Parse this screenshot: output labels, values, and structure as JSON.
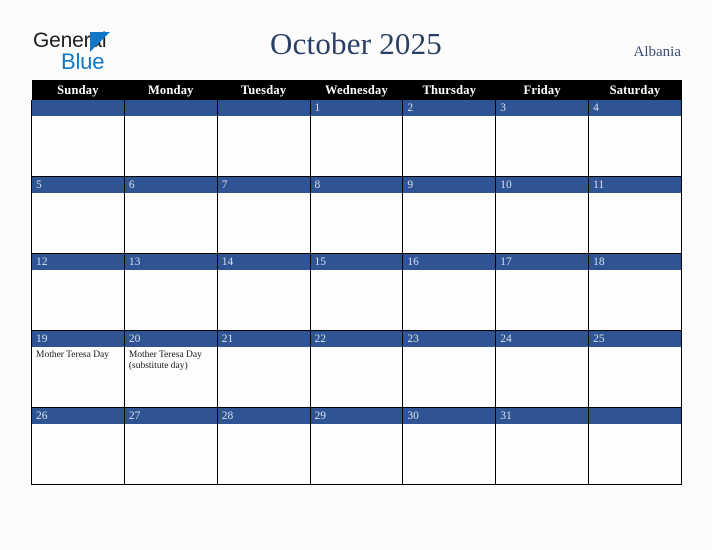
{
  "brand": {
    "name_part1": "General",
    "name_part2": "Blue",
    "triangle_color": "#1277c4"
  },
  "header": {
    "title": "October 2025",
    "region": "Albania"
  },
  "colors": {
    "header_row_bg": "#000000",
    "day_band_bg": "#2e5494",
    "day_number_text": "#d9dfeb",
    "title_text": "#2b3f66",
    "page_bg": "#fcfcfd",
    "grid_line": "#000000"
  },
  "calendar": {
    "weekday_headers": [
      "Sunday",
      "Monday",
      "Tuesday",
      "Wednesday",
      "Thursday",
      "Friday",
      "Saturday"
    ],
    "weeks": [
      [
        {
          "day": "",
          "events": []
        },
        {
          "day": "",
          "events": []
        },
        {
          "day": "",
          "events": []
        },
        {
          "day": "1",
          "events": []
        },
        {
          "day": "2",
          "events": []
        },
        {
          "day": "3",
          "events": []
        },
        {
          "day": "4",
          "events": []
        }
      ],
      [
        {
          "day": "5",
          "events": []
        },
        {
          "day": "6",
          "events": []
        },
        {
          "day": "7",
          "events": []
        },
        {
          "day": "8",
          "events": []
        },
        {
          "day": "9",
          "events": []
        },
        {
          "day": "10",
          "events": []
        },
        {
          "day": "11",
          "events": []
        }
      ],
      [
        {
          "day": "12",
          "events": []
        },
        {
          "day": "13",
          "events": []
        },
        {
          "day": "14",
          "events": []
        },
        {
          "day": "15",
          "events": []
        },
        {
          "day": "16",
          "events": []
        },
        {
          "day": "17",
          "events": []
        },
        {
          "day": "18",
          "events": []
        }
      ],
      [
        {
          "day": "19",
          "events": [
            "Mother Teresa Day"
          ]
        },
        {
          "day": "20",
          "events": [
            "Mother Teresa Day (substitute day)"
          ]
        },
        {
          "day": "21",
          "events": []
        },
        {
          "day": "22",
          "events": []
        },
        {
          "day": "23",
          "events": []
        },
        {
          "day": "24",
          "events": []
        },
        {
          "day": "25",
          "events": []
        }
      ],
      [
        {
          "day": "26",
          "events": []
        },
        {
          "day": "27",
          "events": []
        },
        {
          "day": "28",
          "events": []
        },
        {
          "day": "29",
          "events": []
        },
        {
          "day": "30",
          "events": []
        },
        {
          "day": "31",
          "events": []
        },
        {
          "day": "",
          "events": []
        }
      ]
    ]
  }
}
